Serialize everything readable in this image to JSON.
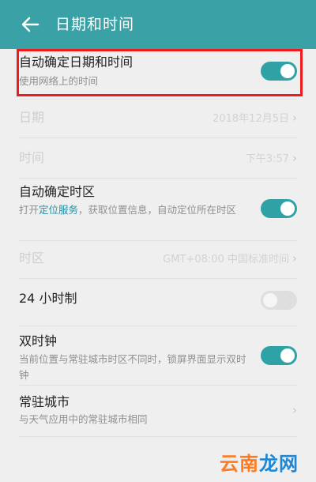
{
  "header": {
    "title": "日期和时间",
    "back_icon": "arrow-left-icon"
  },
  "settings": {
    "auto_datetime": {
      "title": "自动确定日期和时间",
      "subtitle": "使用网络上的时间",
      "enabled": true
    },
    "date": {
      "title": "日期",
      "value": "2018年12月5日"
    },
    "time": {
      "title": "时间",
      "value": "下午3:57"
    },
    "auto_timezone": {
      "title": "自动确定时区",
      "subtitle_prefix": "打开",
      "subtitle_link": "定位服务",
      "subtitle_suffix": "，获取位置信息，自动定位所在时区",
      "enabled": true
    },
    "timezone": {
      "title": "时区",
      "value": "GMT+08:00 中国标准时间"
    },
    "hour24": {
      "title": "24 小时制",
      "enabled": false
    },
    "dual_clock": {
      "title": "双时钟",
      "subtitle": "当前位置与常驻城市时区不同时，锁屏界面显示双时钟",
      "enabled": true
    },
    "home_city": {
      "title": "常驻城市",
      "subtitle": "与天气应用中的常驻城市相同"
    }
  },
  "watermark": {
    "part1": "云南",
    "part2": "龙网"
  },
  "colors": {
    "header": "#3aa2a6",
    "toggle_on": "#2fa2a5",
    "highlight": "#ef1b1b"
  }
}
